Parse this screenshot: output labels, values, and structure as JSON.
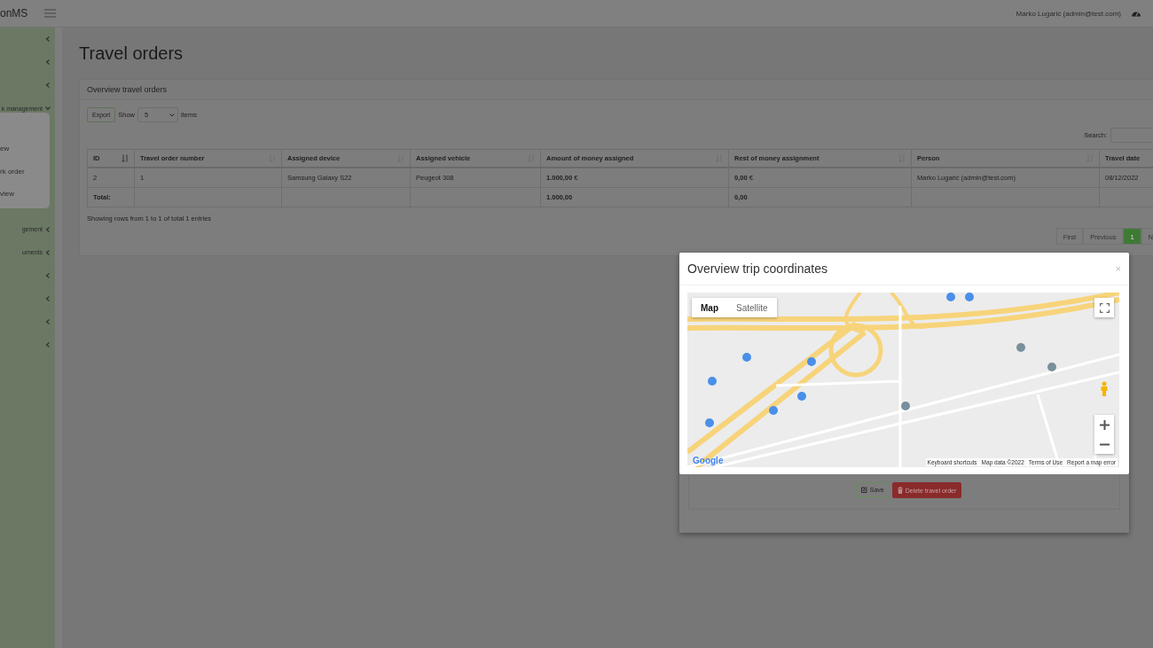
{
  "topbar": {
    "brand": "onMS",
    "user": "Marko Lugarić (admin@test.com)"
  },
  "sidebar": {
    "items": [
      {
        "expanded": false
      },
      {
        "expanded": false
      },
      {
        "expanded": false
      },
      {
        "label": "k management",
        "expanded": true,
        "children": [
          {
            "label": "ew"
          },
          {
            "label": "rk order"
          },
          {
            "label": "view"
          }
        ]
      },
      {
        "label": "gement",
        "expanded": false
      },
      {
        "label": "uments",
        "expanded": false
      },
      {
        "expanded": false
      },
      {
        "expanded": false
      },
      {
        "expanded": false
      },
      {
        "expanded": false
      }
    ]
  },
  "page": {
    "title": "Travel orders"
  },
  "panel": {
    "title": "Overview travel orders",
    "export": "Export",
    "show_label": "Show",
    "page_size": "5",
    "items_label": "items",
    "search_label": "Search:",
    "columns": [
      {
        "label": "ID",
        "sorted": true
      },
      {
        "label": "Travel order number",
        "sorted": false
      },
      {
        "label": "Assigned device",
        "sorted": false
      },
      {
        "label": "Assigned vehicle",
        "sorted": false
      },
      {
        "label": "Amount of money assigned",
        "sorted": false
      },
      {
        "label": "Rest of money assignment",
        "sorted": false
      },
      {
        "label": "Person",
        "sorted": false
      },
      {
        "label": "Travel date"
      }
    ],
    "rows": [
      [
        "2",
        "1",
        "Samsung Galaxy S22",
        "Peugeot 308",
        "**1.000,00** €",
        "**0,00** €",
        "Marko Lugarić (admin@test.com)",
        "08/12/2022"
      ]
    ],
    "total_row": {
      "label": "Total:",
      "amount": "1.000,00",
      "rest": "0,00"
    },
    "summary": "Showing rows from 1 to 1 of total 1 entries",
    "pagination": [
      {
        "label": "First",
        "selected": false
      },
      {
        "label": "Previous",
        "selected": false
      },
      {
        "label": "1",
        "selected": true
      },
      {
        "label": "N",
        "selected": false
      }
    ]
  },
  "back_dialog": {
    "buttons": [
      {
        "label": "Save",
        "kind": "save"
      },
      {
        "label": "Delete travel order",
        "kind": "delete"
      }
    ]
  },
  "modal": {
    "title": "Overview trip coordinates",
    "close": "×",
    "map": {
      "types": [
        {
          "label": "Map",
          "selected": true
        },
        {
          "label": "Satellite",
          "selected": false
        }
      ],
      "logo": "Google",
      "attribution": [
        "Keyboard shortcuts",
        "Map data ©2022",
        "Terms of Use",
        "Report a map error"
      ]
    }
  }
}
